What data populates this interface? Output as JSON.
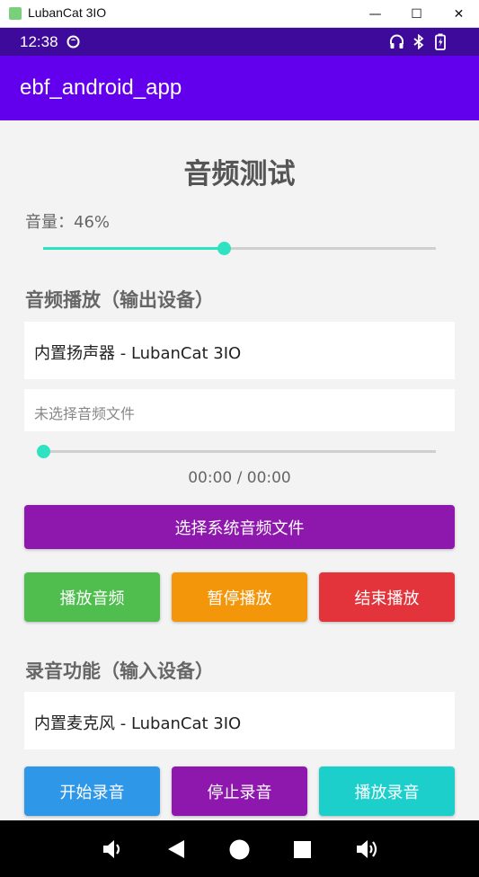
{
  "window": {
    "title": "LubanCat 3IO",
    "minimize": "—",
    "maximize": "☐",
    "close": "✕"
  },
  "status_bar": {
    "time": "12:38"
  },
  "app_bar": {
    "title": "ebf_android_app"
  },
  "page": {
    "title": "音频测试"
  },
  "volume": {
    "label": "音量：46%",
    "level_percent": 46
  },
  "playback": {
    "section_title": "音频播放（输出设备）",
    "device": "内置扬声器 - LubanCat 3IO",
    "file_text": "未选择音频文件",
    "progress_percent": 0,
    "time_text": "00:00 / 00:00",
    "select_button": "选择系统音频文件",
    "play_button": "播放音频",
    "pause_button": "暂停播放",
    "stop_button": "结束播放"
  },
  "recording": {
    "section_title": "录音功能（输入设备）",
    "device": "内置麦克风 - LubanCat 3IO",
    "start_button": "开始录音",
    "stop_button": "停止录音",
    "play_button": "播放录音"
  },
  "colors": {
    "app_bar": "#6200ee",
    "status_bar": "#3e0a9b",
    "accent": "#2fe3c2",
    "select_button": "#8e18ad",
    "play_button": "#4fbe4f",
    "pause_button": "#f3960a",
    "stop_button": "#e3343b",
    "start_record_button": "#2f97e8",
    "stop_record_button": "#8e18ad",
    "play_record_button": "#1ccfcb"
  },
  "icons": {
    "status": [
      "media-circle-icon",
      "headphones-icon",
      "bluetooth-icon",
      "battery-icon"
    ],
    "nav": [
      "volume-down-icon",
      "back-icon",
      "home-icon",
      "recents-icon",
      "volume-up-icon"
    ]
  }
}
